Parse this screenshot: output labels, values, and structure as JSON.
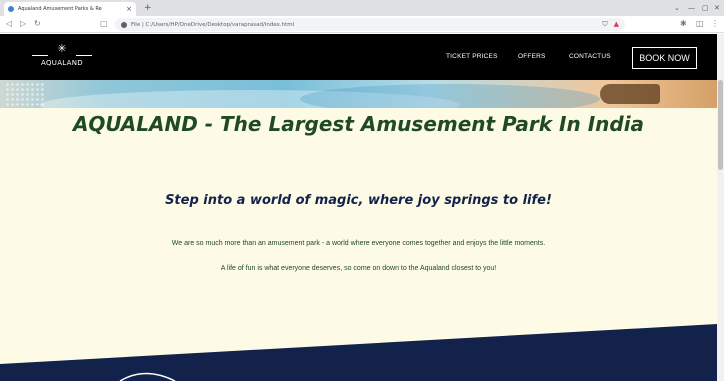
{
  "browser": {
    "tab_title": "Aqualand Amusement Parks & Re",
    "tab_close": "×",
    "new_tab": "+",
    "url": "File | C:/Users/HP/OneDrive/Desktop/varaprasad/index.html",
    "back_icon": "back-arrow",
    "forward_icon": "forward-arrow",
    "reload_icon": "reload",
    "window_controls": [
      "minimize",
      "restore",
      "close"
    ]
  },
  "site": {
    "logo_text": "AQUALAND",
    "nav": {
      "ticket_prices": "TICKET PRICES",
      "offers": "OFFERS",
      "contact": "CONTACTUS",
      "book_now": "BOOK NOW"
    },
    "headline": "AQUALAND - The Largest Amusement Park In India",
    "tagline": "Step into a world of magic, where joy springs to life!",
    "body_1": "We are so much more than an amusement park - a world where everyone comes together and enjoys the little moments.",
    "body_2": "A life of fun is what everyone deserves, so come on down to the Aqualand closest to you!"
  },
  "colors": {
    "nav_bg": "#000000",
    "page_bg": "#fdfbe6",
    "headline": "#1f4a23",
    "tagline": "#13224a",
    "band": "#13224a"
  }
}
